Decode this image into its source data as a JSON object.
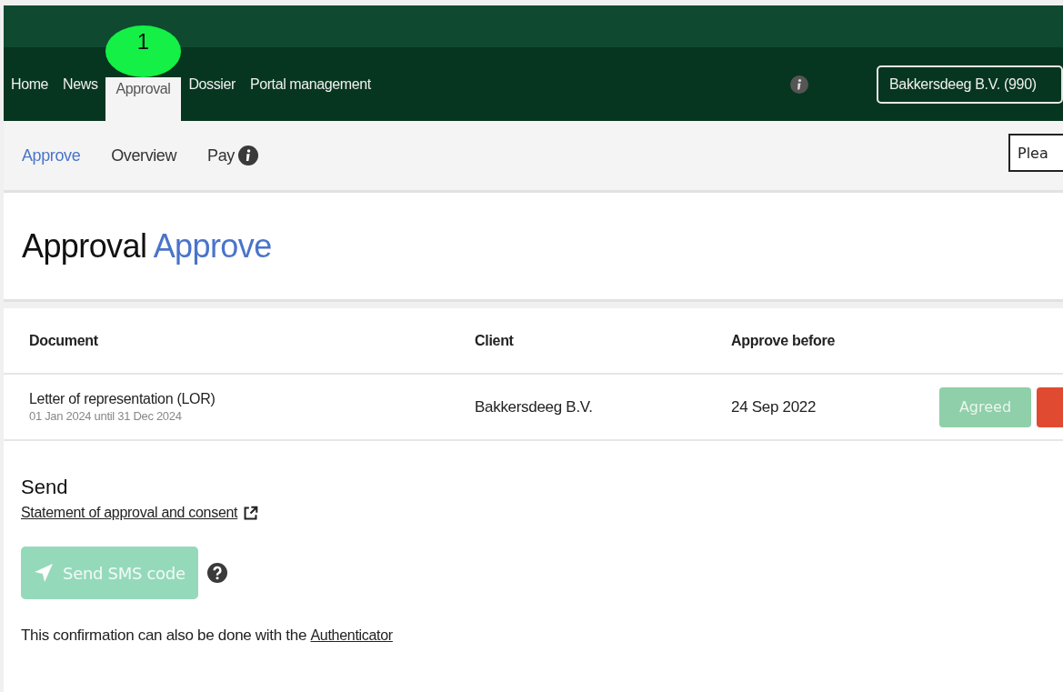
{
  "nav": {
    "tabs": [
      {
        "label": "Home",
        "selected": false
      },
      {
        "label": "News",
        "selected": false
      },
      {
        "label": "Approval",
        "selected": true
      },
      {
        "label": "Dossier",
        "selected": false
      },
      {
        "label": "Portal management",
        "selected": false
      }
    ],
    "step_badge": "1",
    "company_select": "Bakkersdeeg B.V. (990)"
  },
  "subnav": {
    "tabs": [
      {
        "label": "Approve",
        "selected": true,
        "info": false
      },
      {
        "label": "Overview",
        "selected": false,
        "info": false
      },
      {
        "label": "Pay",
        "selected": false,
        "info": true
      }
    ],
    "search": {
      "placeholder": "Plea"
    }
  },
  "page_title": {
    "section": "Approval",
    "page": "Approve"
  },
  "table": {
    "columns": [
      "Document",
      "Client",
      "Approve before"
    ],
    "rows": [
      {
        "document": "Letter of representation (LOR)",
        "period": "01 Jan 2024 until 31 Dec 2024",
        "client": "Bakkersdeeg B.V.",
        "approve_before": "24 Sep 2022",
        "actions": [
          {
            "kind": "agree",
            "label": "Agreed",
            "disabled": true
          },
          {
            "kind": "reject"
          }
        ]
      }
    ]
  },
  "send": {
    "heading": "Send",
    "statement_link": "Statement of approval and consent",
    "sms_button": {
      "label": "Send SMS code",
      "disabled": true
    },
    "note": "This confirmation can also be done with the",
    "note_link": "Authenticator"
  }
}
